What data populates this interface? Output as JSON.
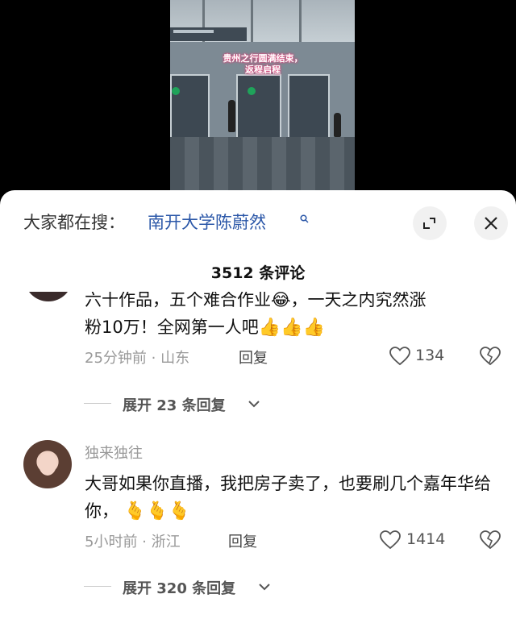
{
  "video": {
    "caption": "贵州之行圆满结束，返程启程"
  },
  "search": {
    "prefix": "大家都在搜：",
    "term": "南开大学陈蔚然"
  },
  "comments_header": {
    "count_label": "3512 条评论"
  },
  "comments": [
    {
      "line1": "六十作品，五个难合作业😂，一天之内究然涨",
      "line2": "粉10万！全网第一人吧",
      "emojis": "👍👍👍",
      "time_location": "25分钟前 · 山东",
      "reply_label": "回复",
      "likes": "134",
      "expand_label": "展开 23 条回复"
    },
    {
      "username": "独来独往",
      "text": "大哥如果你直播，我把房子卖了，也要刷几个嘉年华给你，",
      "emojis": "🫰🫰🫰",
      "time_location": "5小时前 · 浙江",
      "reply_label": "回复",
      "likes": "1414",
      "expand_label": "展开 320 条回复"
    }
  ]
}
